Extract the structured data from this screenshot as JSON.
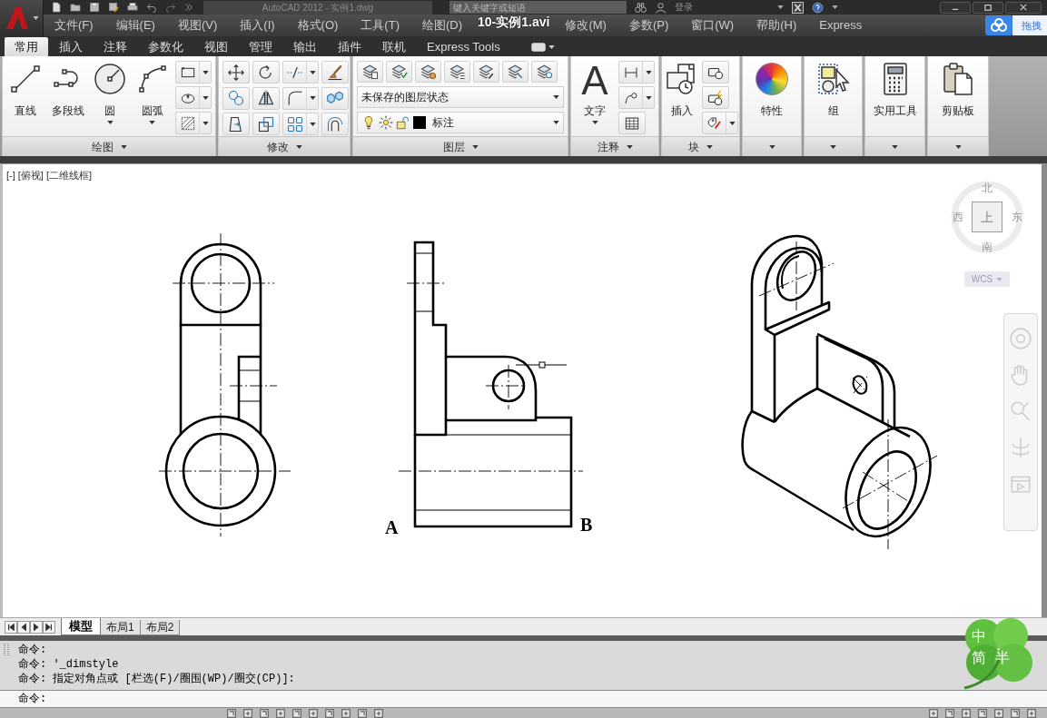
{
  "title_bar": {
    "title": "AutoCAD 2012 - 实例1.dwg",
    "search": {
      "placeholder": "键入关键字或短语"
    },
    "sign_in": "登录"
  },
  "menu_bar": [
    {
      "kind": "menu",
      "label": "文件(F)"
    },
    {
      "kind": "menu",
      "label": "编辑(E)"
    },
    {
      "kind": "menu",
      "label": "视图(V)"
    },
    {
      "kind": "menu",
      "label": "插入(I)"
    },
    {
      "kind": "menu",
      "label": "格式(O)"
    },
    {
      "kind": "menu",
      "label": "工具(T)"
    },
    {
      "kind": "menu",
      "label": "绘图(D)"
    },
    {
      "kind": "video_title",
      "label": "10-实例1.avi"
    },
    {
      "kind": "menu",
      "label": "修改(M)"
    },
    {
      "kind": "menu",
      "label": "参数(P)"
    },
    {
      "kind": "menu",
      "label": "窗口(W)"
    },
    {
      "kind": "menu",
      "label": "帮助(H)"
    },
    {
      "kind": "menu",
      "label": "Express"
    }
  ],
  "cloud_widget": {
    "label": "拖拽"
  },
  "ribbon": {
    "tabs": [
      {
        "label": "常用",
        "selected": true
      },
      {
        "label": "插入",
        "selected": false
      },
      {
        "label": "注释",
        "selected": false
      },
      {
        "label": "参数化",
        "selected": false
      },
      {
        "label": "视图",
        "selected": false
      },
      {
        "label": "管理",
        "selected": false
      },
      {
        "label": "输出",
        "selected": false
      },
      {
        "label": "插件",
        "selected": false
      },
      {
        "label": "联机",
        "selected": false
      },
      {
        "label": "Express Tools",
        "selected": false
      }
    ],
    "panels": [
      {
        "kind": "draw",
        "title": "绘图",
        "buttons": [
          {
            "label": "直线",
            "dropdown": false
          },
          {
            "label": "多段线",
            "dropdown": false
          },
          {
            "label": "圆",
            "dropdown": true
          },
          {
            "label": "圆弧",
            "dropdown": true
          }
        ]
      },
      {
        "kind": "modify",
        "title": "修改"
      },
      {
        "kind": "layers",
        "title": "图层",
        "layer_state": "未保存的图层状态",
        "current_layer": "标注"
      },
      {
        "kind": "annotation",
        "title": "注释",
        "text_button": {
          "glyph": "A",
          "label": "文字",
          "dropdown": true
        }
      },
      {
        "kind": "block",
        "title": "块",
        "insert_button": {
          "label": "插入",
          "dropdown": false
        }
      },
      {
        "kind": "properties",
        "label": "特性"
      },
      {
        "kind": "groups",
        "label": "组"
      },
      {
        "kind": "utilities",
        "label": "实用工具"
      },
      {
        "kind": "clipboard",
        "label": "剪贴板"
      }
    ]
  },
  "viewport": {
    "controls": [
      "[-]",
      "[俯视]",
      "[二维线框]"
    ],
    "labels": [
      "A",
      "B"
    ],
    "viewcube": {
      "north": "北",
      "west": "西",
      "face": "上",
      "east": "东",
      "south": "南",
      "ucs": "WCS"
    }
  },
  "layout_tabs": [
    {
      "label": "模型",
      "selected": true
    },
    {
      "label": "布局1",
      "selected": false
    },
    {
      "label": "布局2",
      "selected": false
    }
  ],
  "command_line": {
    "history": [
      "命令:",
      "命令: '_dimstyle",
      "命令: 指定对角点或 [栏选(F)/圈围(WP)/圈交(CP)]:"
    ],
    "prompt": "命令:"
  },
  "ime_widget": {
    "mode": "中",
    "script": "简",
    "width": "半"
  }
}
